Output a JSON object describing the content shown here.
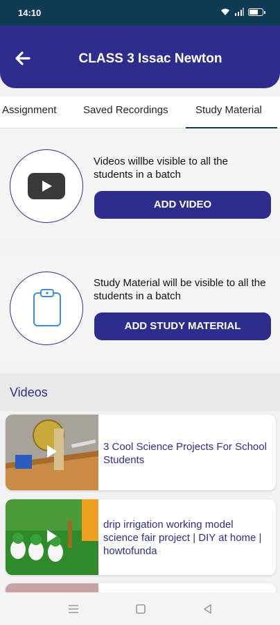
{
  "status_bar": {
    "time": "14:10",
    "icons": [
      "wifi-icon",
      "signal-icon",
      "battery-icon"
    ]
  },
  "app_bar": {
    "title": "CLASS 3 Issac Newton",
    "back_icon": "arrow-left-icon"
  },
  "tabs": [
    {
      "label": "Assignment",
      "active": false
    },
    {
      "label": "Saved Recordings",
      "active": false
    },
    {
      "label": "Study Material",
      "active": true
    }
  ],
  "video_card": {
    "icon": "youtube-play-icon",
    "description": "Videos willbe visible to all the students in a batch",
    "button_label": "ADD VIDEO"
  },
  "study_card": {
    "icon": "clipboard-icon",
    "description": "Study Material will be visible to all the students in a batch",
    "button_label": "ADD STUDY MATERIAL"
  },
  "videos_section": {
    "heading": "Videos",
    "items": [
      {
        "title": "3 Cool Science Projects For School Students"
      },
      {
        "title": "drip irrigation working model science fair project | DIY at home | howtofunda"
      }
    ]
  },
  "nav_bar": {
    "icons": [
      "menu-icon",
      "home-square-icon",
      "back-triangle-icon"
    ]
  },
  "colors": {
    "primary": "#2e2d8e",
    "status_bar": "#0e3a53"
  }
}
